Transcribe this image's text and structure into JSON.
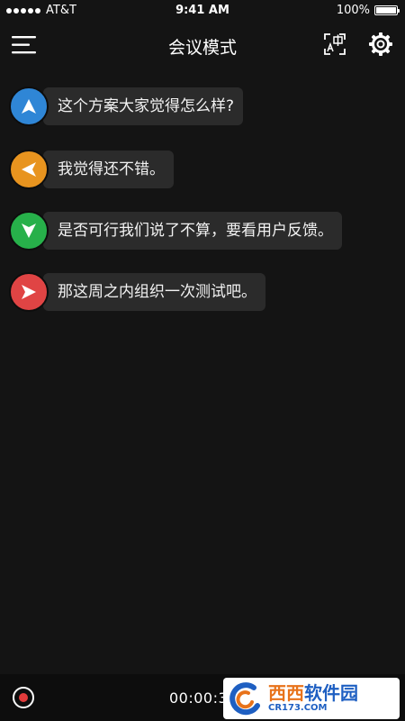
{
  "status_bar": {
    "carrier": "AT&T",
    "time": "9:41 AM",
    "battery_percent": "100%",
    "battery_level": 1.0
  },
  "nav": {
    "title": "会议模式",
    "menu_icon": "hamburger-menu-icon",
    "translate_icon": "translate-icon",
    "settings_icon": "gear-icon"
  },
  "messages": [
    {
      "text": "这个方案大家觉得怎么样?",
      "avatar_color": "#2f86d6",
      "avatar_direction": "up"
    },
    {
      "text": "我觉得还不错。",
      "avatar_color": "#e8941f",
      "avatar_direction": "left"
    },
    {
      "text": "是否可行我们说了不算，要看用户反馈。",
      "avatar_color": "#27b04a",
      "avatar_direction": "down"
    },
    {
      "text": "那这周之内组织一次测试吧。",
      "avatar_color": "#e04444",
      "avatar_direction": "right"
    }
  ],
  "bottom": {
    "record_icon": "record-icon",
    "timer": "00:00:3"
  },
  "watermark": {
    "brand_a": "西西",
    "brand_b": "软件园",
    "url": "CR173.COM"
  },
  "colors": {
    "background": "#141414",
    "bubble": "#2b2b2b",
    "record_dot": "#e23b3b"
  }
}
